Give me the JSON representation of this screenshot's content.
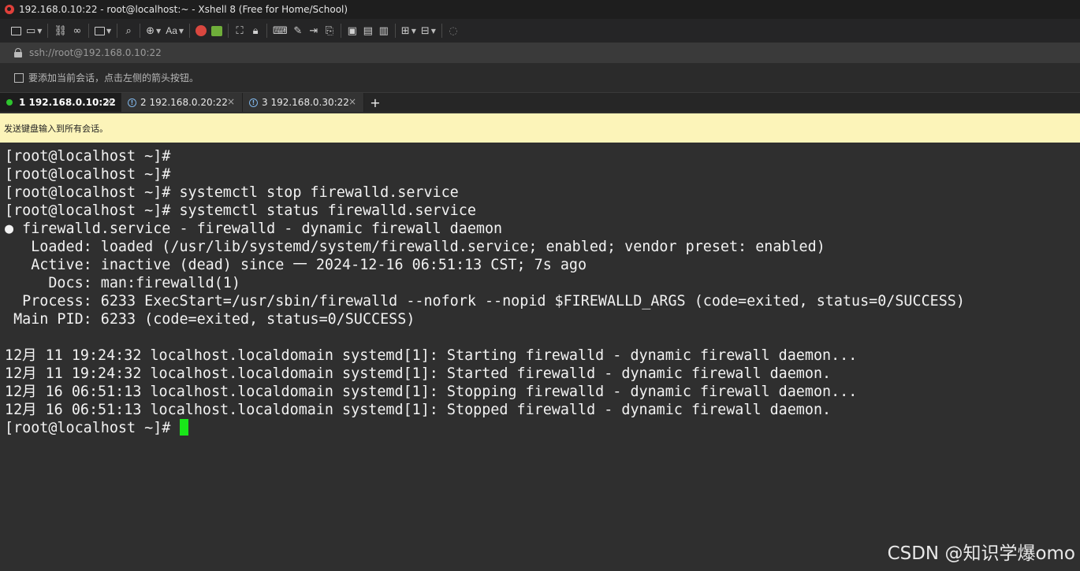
{
  "window": {
    "title": "192.168.0.10:22 - root@localhost:~ - Xshell 8 (Free for Home/School)"
  },
  "toolbar": {
    "font_button_label": "Aa"
  },
  "address": {
    "url": "ssh://root@192.168.0.10:22"
  },
  "session_hint": {
    "text": "要添加当前会话，点击左侧的箭头按钮。"
  },
  "tabs": [
    {
      "label": "1 192.168.0.10:22",
      "status": "connected",
      "active": true
    },
    {
      "label": "2 192.168.0.20:22",
      "status": "warning",
      "active": false
    },
    {
      "label": "3 192.168.0.30:22",
      "status": "warning",
      "active": false
    }
  ],
  "tab_add_label": "+",
  "tab_close_glyph": "×",
  "notification": {
    "text": "发送键盘输入到所有会话。"
  },
  "terminal": {
    "lines": [
      "[root@localhost ~]#",
      "[root@localhost ~]#",
      "[root@localhost ~]# systemctl stop firewalld.service",
      "[root@localhost ~]# systemctl status firewalld.service",
      "● firewalld.service - firewalld - dynamic firewall daemon",
      "   Loaded: loaded (/usr/lib/systemd/system/firewalld.service; enabled; vendor preset: enabled)",
      "   Active: inactive (dead) since 一 2024-12-16 06:51:13 CST; 7s ago",
      "     Docs: man:firewalld(1)",
      "  Process: 6233 ExecStart=/usr/sbin/firewalld --nofork --nopid $FIREWALLD_ARGS (code=exited, status=0/SUCCESS)",
      " Main PID: 6233 (code=exited, status=0/SUCCESS)",
      "",
      "12月 11 19:24:32 localhost.localdomain systemd[1]: Starting firewalld - dynamic firewall daemon...",
      "12月 11 19:24:32 localhost.localdomain systemd[1]: Started firewalld - dynamic firewall daemon.",
      "12月 16 06:51:13 localhost.localdomain systemd[1]: Stopping firewalld - dynamic firewall daemon...",
      "12月 16 06:51:13 localhost.localdomain systemd[1]: Stopped firewalld - dynamic firewall daemon."
    ],
    "prompt": "[root@localhost ~]# ",
    "cursor_color": "#19e619"
  },
  "watermark": "CSDN @知识学爆omo",
  "colors": {
    "terminal_bg": "#2f2f2f",
    "notification_bg": "#fcf4b9",
    "connected_dot": "#2ec52e"
  }
}
